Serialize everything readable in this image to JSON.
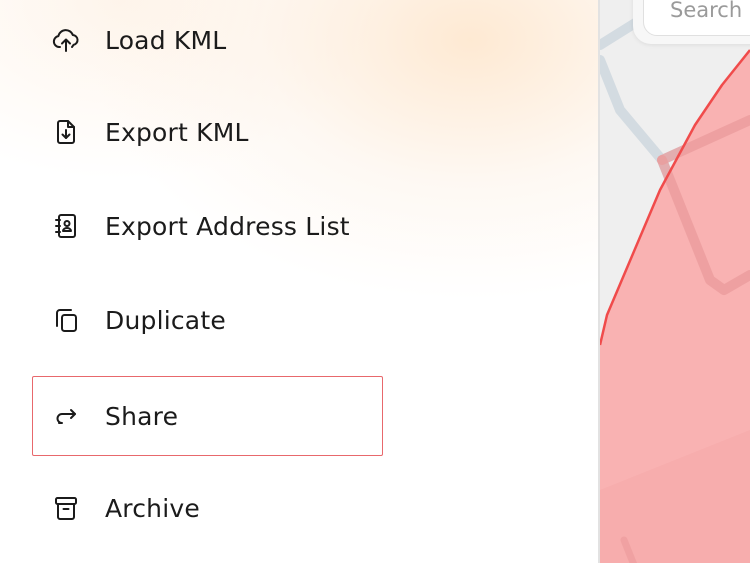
{
  "menu": {
    "items": [
      {
        "label": "Load KML",
        "icon": "cloud-upload-icon"
      },
      {
        "label": "Export KML",
        "icon": "file-download-icon"
      },
      {
        "label": "Export Address List",
        "icon": "address-book-icon"
      },
      {
        "label": "Duplicate",
        "icon": "copy-icon"
      },
      {
        "label": "Share",
        "icon": "share-arrow-icon"
      },
      {
        "label": "Archive",
        "icon": "archive-box-icon"
      }
    ],
    "selected_index": 4
  },
  "map": {
    "search_placeholder": "Search",
    "polygon_fill": "#f9aeae",
    "polygon_stroke": "#f04b4b",
    "road_color": "#cfd9e0"
  },
  "colors": {
    "selected_border": "#e8686c",
    "text": "#1b1b1b",
    "warm_gradient": "#fde2c4"
  }
}
